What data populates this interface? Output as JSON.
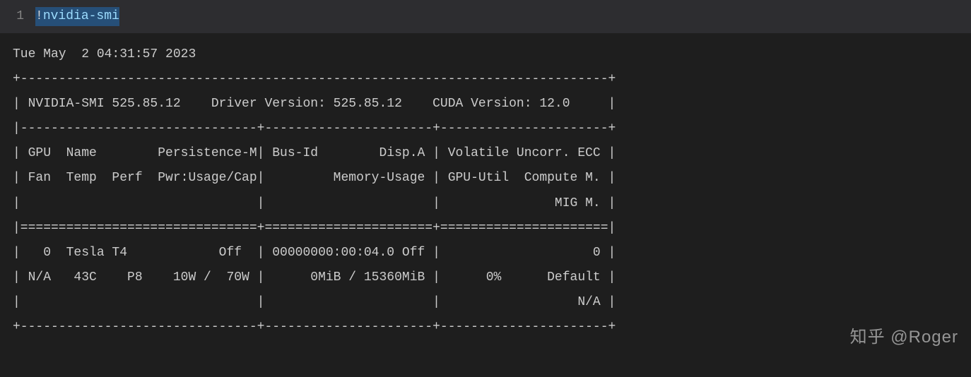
{
  "cell": {
    "line_number": "1",
    "bang": "!",
    "command": "nvidia-smi"
  },
  "output": {
    "timestamp": "Tue May  2 04:31:57 2023",
    "border_top": "+-----------------------------------------------------------------------------+",
    "header_line": "| NVIDIA-SMI 525.85.12    Driver Version: 525.85.12    CUDA Version: 12.0     |",
    "smi_version": "525.85.12",
    "driver_version": "525.85.12",
    "cuda_version": "12.0",
    "divider1": "|-------------------------------+----------------------+----------------------+",
    "col_header1": "| GPU  Name        Persistence-M| Bus-Id        Disp.A | Volatile Uncorr. ECC |",
    "col_header2": "| Fan  Temp  Perf  Pwr:Usage/Cap|         Memory-Usage | GPU-Util  Compute M. |",
    "col_header3": "|                               |                      |               MIG M. |",
    "divider2": "|===============================+======================+======================|",
    "gpu_row1": "|   0  Tesla T4            Off  | 00000000:00:04.0 Off |                    0 |",
    "gpu_row2": "| N/A   43C    P8    10W /  70W |      0MiB / 15360MiB |      0%      Default |",
    "gpu_row3": "|                               |                      |                  N/A |",
    "border_bottom": "+-------------------------------+----------------------+----------------------+",
    "gpu": {
      "index": "0",
      "name": "Tesla T4",
      "persistence_m": "Off",
      "bus_id": "00000000:00:04.0",
      "disp_a": "Off",
      "fan": "N/A",
      "temp": "43C",
      "perf": "P8",
      "pwr_usage": "10W",
      "pwr_cap": "70W",
      "mem_used": "0MiB",
      "mem_total": "15360MiB",
      "gpu_util": "0%",
      "compute_m": "Default",
      "volatile_ecc": "0",
      "mig_m": "N/A"
    }
  },
  "watermark": "知乎 @Roger"
}
